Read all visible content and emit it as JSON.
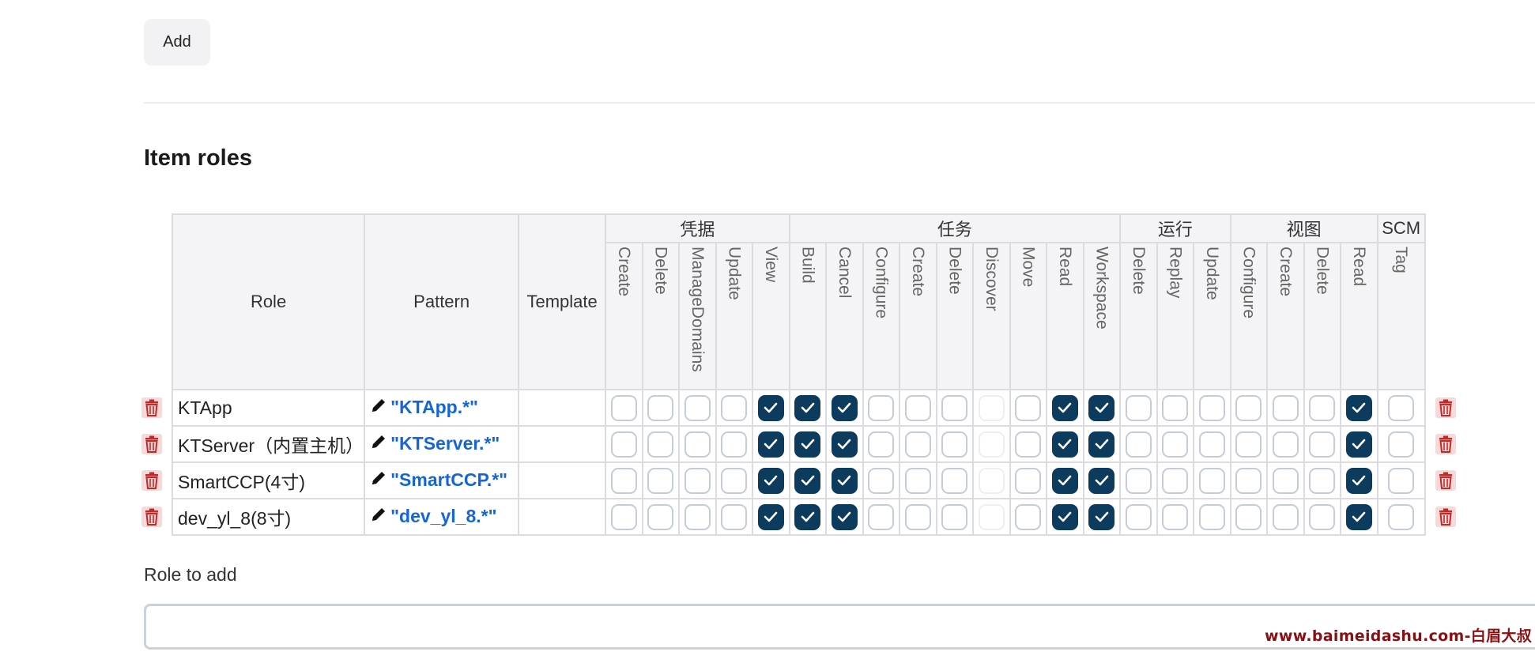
{
  "toolbar": {
    "add_label": "Add"
  },
  "section": {
    "title": "Item roles"
  },
  "table": {
    "headers": {
      "role": "Role",
      "pattern": "Pattern",
      "template": "Template"
    },
    "groups": [
      {
        "label": "凭据",
        "perms": [
          "Create",
          "Delete",
          "ManageDomains",
          "Update",
          "View"
        ]
      },
      {
        "label": "任务",
        "perms": [
          "Build",
          "Cancel",
          "Configure",
          "Create",
          "Delete",
          "Discover",
          "Move",
          "Read",
          "Workspace"
        ]
      },
      {
        "label": "运行",
        "perms": [
          "Delete",
          "Replay",
          "Update"
        ]
      },
      {
        "label": "视图",
        "perms": [
          "Configure",
          "Create",
          "Delete",
          "Read"
        ]
      },
      {
        "label": "SCM",
        "perms": [
          "Tag"
        ]
      }
    ],
    "rows": [
      {
        "role": "KTApp",
        "pattern": "\"KTApp.*\"",
        "checks": [
          0,
          0,
          0,
          0,
          1,
          1,
          1,
          0,
          0,
          0,
          0,
          0,
          1,
          1,
          0,
          0,
          0,
          0,
          0,
          0,
          1,
          0
        ]
      },
      {
        "role": "KTServer（内置主机）",
        "pattern": "\"KTServer.*\"",
        "checks": [
          0,
          0,
          0,
          0,
          1,
          1,
          1,
          0,
          0,
          0,
          0,
          0,
          1,
          1,
          0,
          0,
          0,
          0,
          0,
          0,
          1,
          0
        ]
      },
      {
        "role": "SmartCCP(4寸)",
        "pattern": "\"SmartCCP.*\"",
        "checks": [
          0,
          0,
          0,
          0,
          1,
          1,
          1,
          0,
          0,
          0,
          0,
          0,
          1,
          1,
          0,
          0,
          0,
          0,
          0,
          0,
          1,
          0
        ]
      },
      {
        "role": "dev_yl_8(8寸)",
        "pattern": "\"dev_yl_8.*\"",
        "checks": [
          0,
          0,
          0,
          0,
          1,
          1,
          1,
          0,
          0,
          0,
          0,
          0,
          1,
          1,
          0,
          0,
          0,
          0,
          0,
          0,
          1,
          0
        ]
      }
    ],
    "disabled_columns": [
      10
    ]
  },
  "role_to_add": {
    "label": "Role to add",
    "value": ""
  },
  "watermark": "www.baimeidashu.com-白眉大叔",
  "colors": {
    "checked": "#0d3b5e",
    "link": "#1565d8",
    "trash_bg": "#f7d9d9",
    "trash": "#c62828",
    "watermark": "#8a0f12"
  },
  "icons": {
    "edit": "pencil-icon",
    "delete": "trash-icon",
    "check": "checkmark-icon"
  }
}
